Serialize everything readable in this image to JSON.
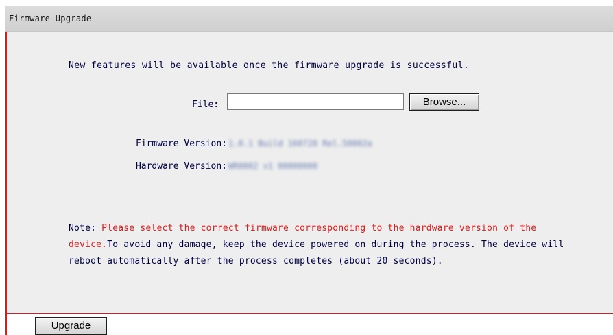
{
  "header": {
    "title": "Firmware Upgrade"
  },
  "main": {
    "intro": "New features will be available once the firmware upgrade is successful.",
    "file_label": "File:",
    "file_input_value": "",
    "browse_label": "Browse...",
    "firmware_version_label": "Firmware Version:",
    "firmware_version_value": "1.0.1 Build 160720 Rel.50002a",
    "hardware_version_label": "Hardware Version:",
    "hardware_version_value": "WR0002 v1 00000000",
    "note_label": "Note:",
    "note_highlight": "Please select the correct firmware corresponding to the hardware version of the device.",
    "note_text": "To avoid any damage, keep the device powered on during the process. The device will reboot automatically after the process completes (about 20 seconds)."
  },
  "footer": {
    "upgrade_label": "Upgrade"
  },
  "colors": {
    "accent_border": "#d61c1c",
    "note_red": "#e21b1b",
    "panel_bg": "#eeeeee",
    "titlebar_bg": "#d4d4d4"
  }
}
